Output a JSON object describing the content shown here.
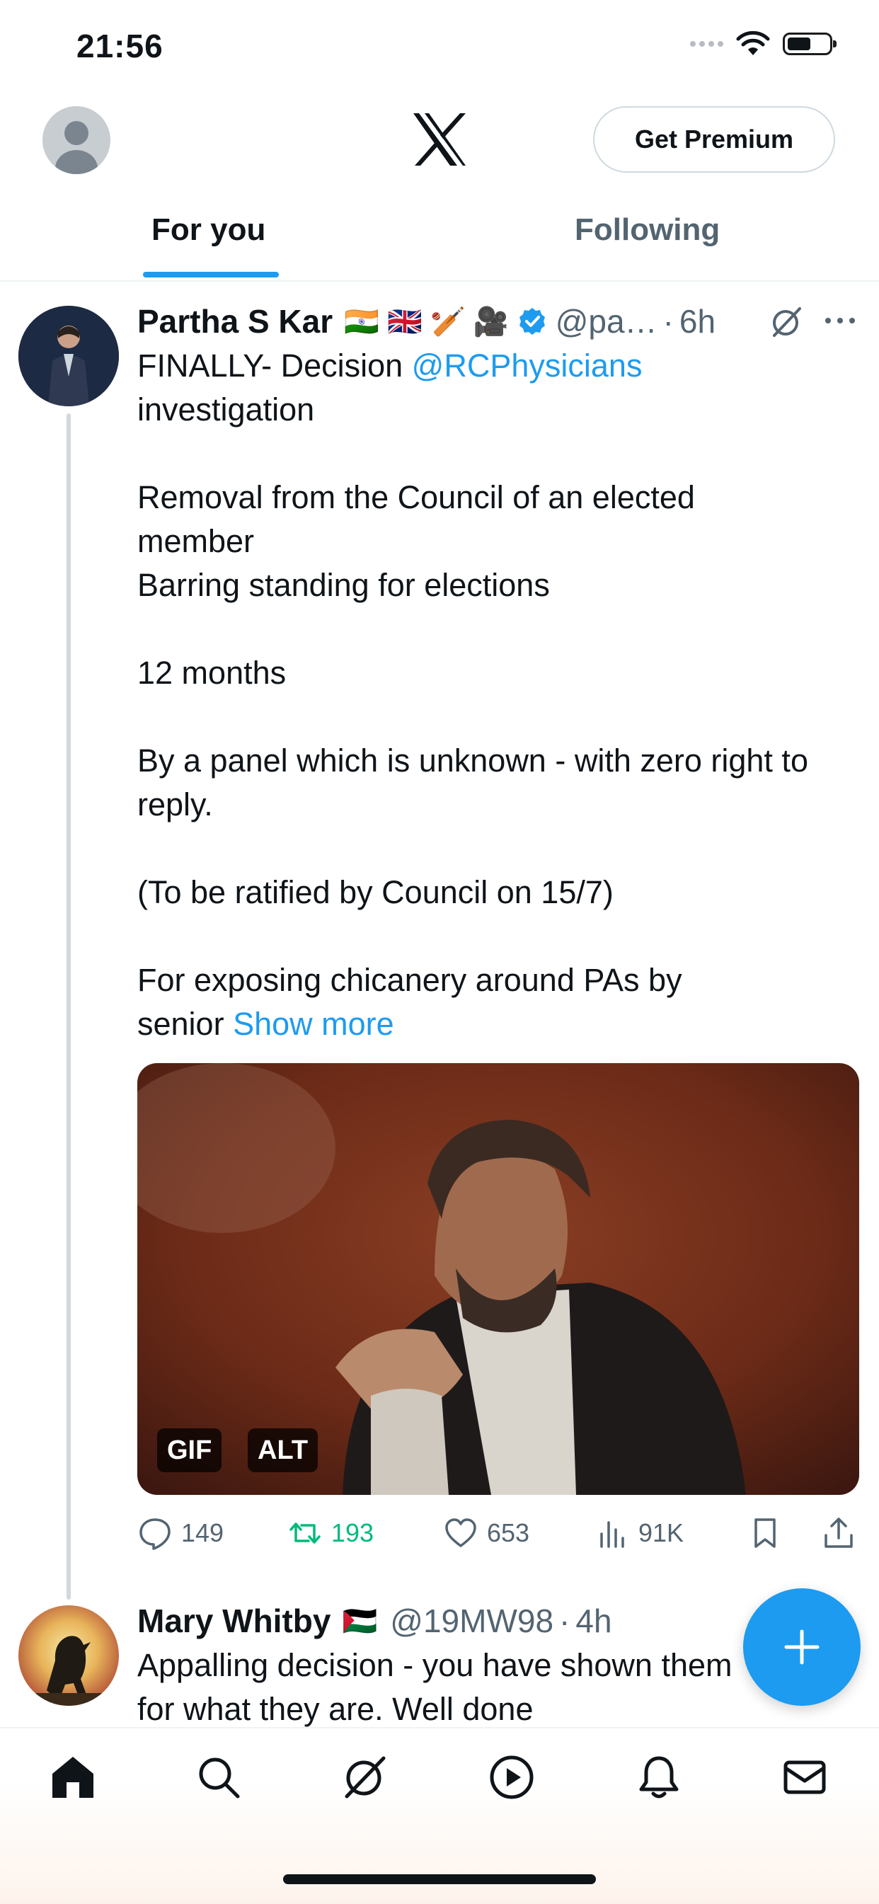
{
  "status_bar": {
    "time": "21:56"
  },
  "header": {
    "premium_label": "Get Premium"
  },
  "tabs": [
    {
      "label": "For you",
      "active": true
    },
    {
      "label": "Following",
      "active": false
    }
  ],
  "tweets": [
    {
      "name": "Partha S Kar",
      "emojis": "🇮🇳 🇬🇧 🏏 🎥",
      "handle": "@pa…",
      "time": "6h",
      "body": {
        "line1_text": "FINALLY- Decision ",
        "line1_mention": "@RCPhysicians",
        "line2": "investigation",
        "para2_line1": "Removal from the Council of an elected",
        "para2_line2": "member",
        "para2_line3": "Barring standing for elections",
        "para3": "12 months",
        "para4_line1": "By a panel which is unknown - with zero right to",
        "para4_line2": "reply.",
        "para5": "(To be ratified by Council on 15/7)",
        "para6_line1": "For exposing chicanery around PAs by",
        "para6_line2": "senior ",
        "show_more": "Show more"
      },
      "media": {
        "gif_badge": "GIF",
        "alt_badge": "ALT"
      },
      "stats": {
        "replies": "149",
        "reposts": "193",
        "likes": "653",
        "views": "91K"
      }
    },
    {
      "name": "Mary Whitby",
      "emojis": "🇵🇸",
      "handle": "@19MW98",
      "time": "4h",
      "body_line1": "Appalling decision - you have shown them",
      "body_line2": "for what they are. Well done"
    }
  ],
  "colors": {
    "accent": "#1d9bf0",
    "repost": "#00ba7c",
    "secondary_text": "#536471"
  },
  "nav_icons": [
    "home-icon",
    "search-icon",
    "grok-icon",
    "video-icon",
    "notifications-icon",
    "messages-icon"
  ]
}
